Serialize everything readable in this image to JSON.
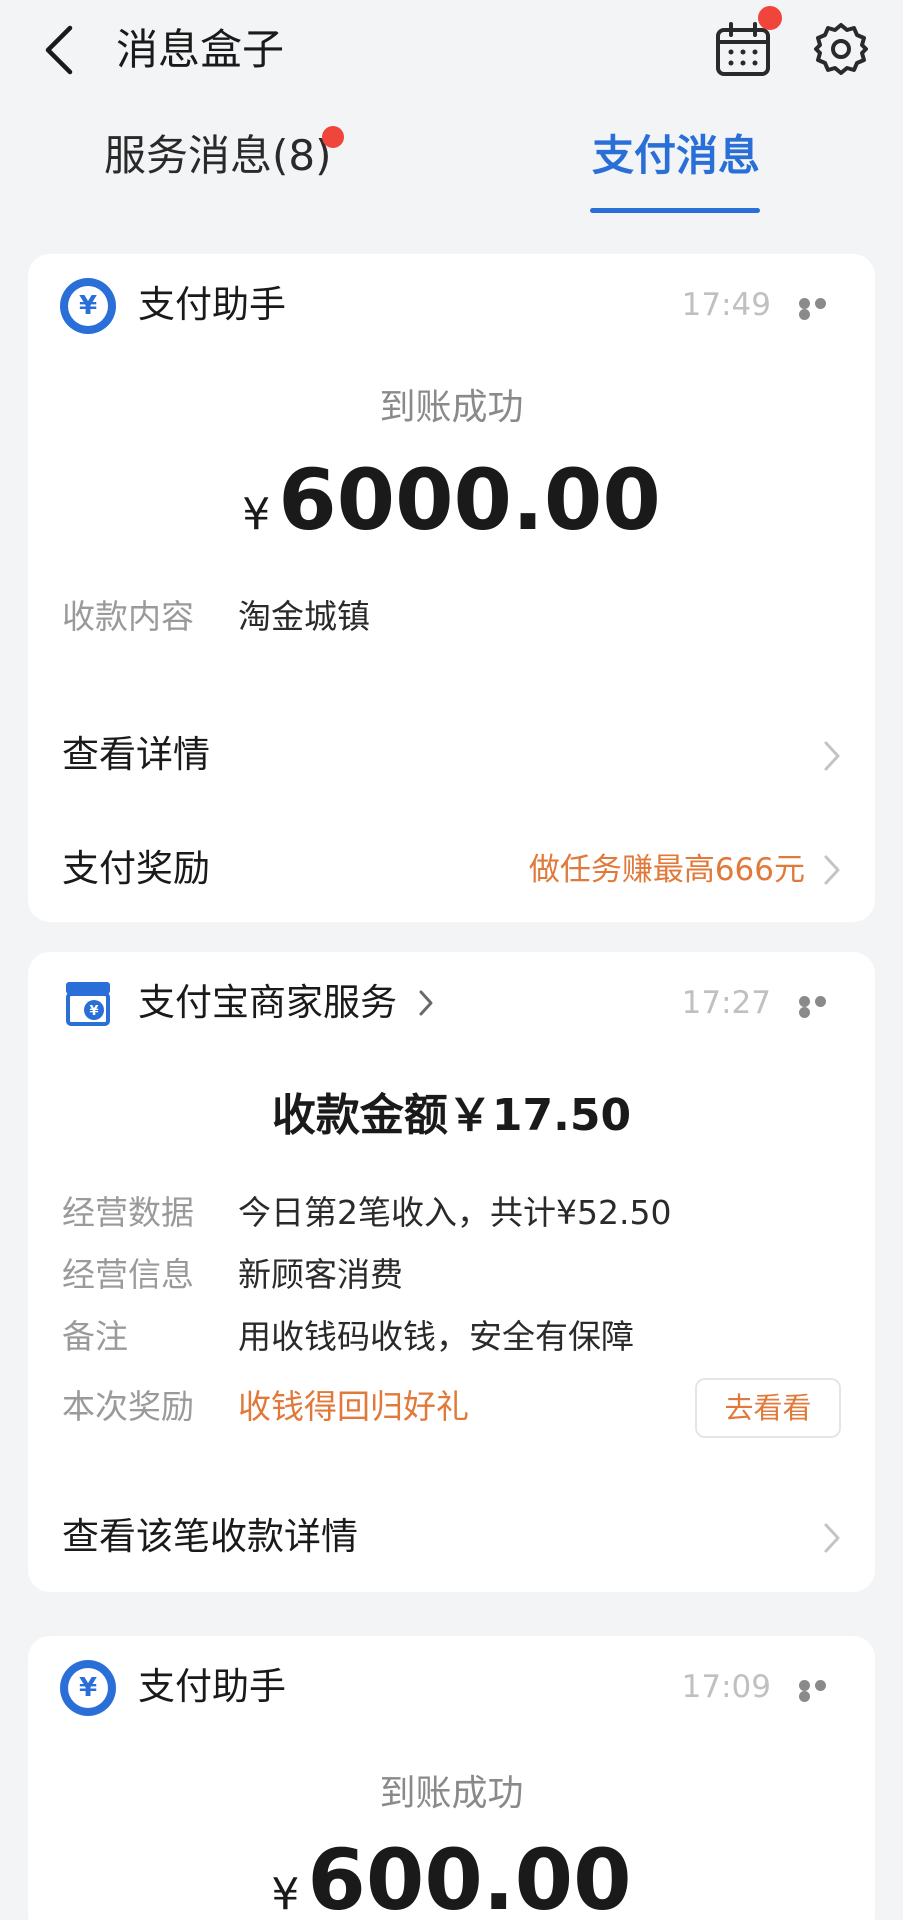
{
  "header": {
    "title": "消息盒子",
    "icons": [
      "back-arrow-icon",
      "calendar-icon",
      "gear-icon"
    ],
    "calendar_badge": true
  },
  "tabs": {
    "service": "服务消息(8)",
    "pay": "支付消息",
    "active": "pay"
  },
  "cards": [
    {
      "sender": "支付助手",
      "time": "17:49",
      "subtitle": "到账成功",
      "currency": "¥",
      "amount": "6000.00",
      "fields": [
        {
          "key": "收款内容",
          "value": "淘金城镇"
        }
      ],
      "rows": [
        {
          "label": "查看详情"
        },
        {
          "label": "支付奖励",
          "extra": "做任务赚最高666元"
        }
      ]
    },
    {
      "sender": "支付宝商家服务",
      "time": "17:27",
      "headline": "收款金额￥17.50",
      "fields": [
        {
          "key": "经营数据",
          "value": "今日第2笔收入，共计¥52.50"
        },
        {
          "key": "经营信息",
          "value": "新顾客消费"
        },
        {
          "key": "备注",
          "value": "用收钱码收钱，安全有保障"
        },
        {
          "key": "本次奖励",
          "value": "收钱得回归好礼"
        }
      ],
      "button": "去看看",
      "rows": [
        {
          "label": "查看该笔收款详情"
        }
      ]
    },
    {
      "sender": "支付助手",
      "time": "17:09",
      "subtitle": "到账成功",
      "currency": "¥",
      "amount": "600.00"
    }
  ],
  "colors": {
    "accent": "#2a6fd8",
    "badge": "#f0453a",
    "orange": "#e0793a",
    "background": "#f3f4f6"
  }
}
